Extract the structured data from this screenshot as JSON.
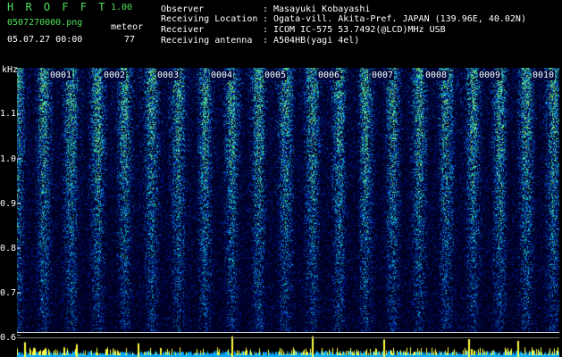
{
  "header": {
    "brand": "H R O F F T",
    "version": "1.00",
    "filename": "0507270000.png",
    "meteor_label": "meteor",
    "datetime": "05.07.27 00:00",
    "meteor_count": "77"
  },
  "info": {
    "observer_label": "Observer",
    "observer_value": "Masayuki Kobayashi",
    "location_label": "Receiving Location",
    "location_value": "Ogata-vill. Akita-Pref. JAPAN (139.96E, 40.02N)",
    "receiver_label": "Receiver",
    "receiver_value": "ICOM IC-575 53.7492(@LCD)MHz USB",
    "antenna_label": "Receiving antenna",
    "antenna_value": "A504HB(yagi 4el)",
    "separator": ":"
  },
  "axis": {
    "unit": "kHz",
    "y_ticks": [
      "1.1",
      "1.0",
      "0.9",
      "0.8",
      "0.7",
      "0.6"
    ],
    "x_ticks": [
      "0001",
      "0002",
      "0003",
      "0004",
      "0005",
      "0006",
      "0007",
      "0008",
      "0009",
      "0010"
    ]
  },
  "colors": {
    "header_green": "#4de05a",
    "background": "#000000",
    "spectrum_low": "#00085a",
    "spectrum_high": "#40ff60",
    "meteor_bar": "#ffff40",
    "baseline": "#00b0ff"
  }
}
